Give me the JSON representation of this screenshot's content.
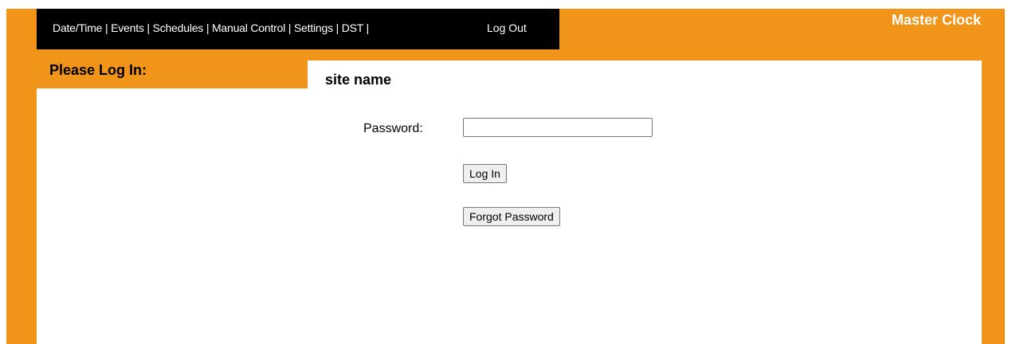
{
  "nav": {
    "items": [
      {
        "label": "Date/Time"
      },
      {
        "label": "Events"
      },
      {
        "label": "Schedules"
      },
      {
        "label": "Manual Control"
      },
      {
        "label": "Settings"
      },
      {
        "label": "DST"
      }
    ],
    "separator": " | ",
    "logout": "Log Out"
  },
  "brand": "Master Clock",
  "left_panel": {
    "header": "Please Log In:"
  },
  "main": {
    "site_name": "site name",
    "password_label": "Password:",
    "password_value": "",
    "login_button": "Log In",
    "forgot_button": "Forgot Password"
  },
  "colors": {
    "frame": "#f0941a",
    "navbar": "#000000",
    "panel": "#ffffff"
  }
}
